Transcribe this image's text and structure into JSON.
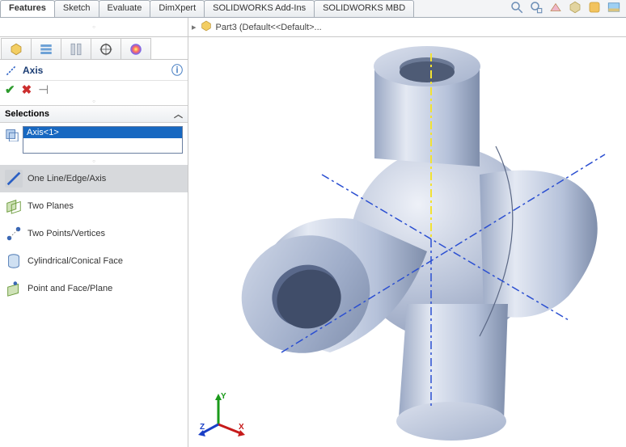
{
  "cmd_tabs": [
    "Features",
    "Sketch",
    "Evaluate",
    "DimXpert",
    "SOLIDWORKS Add-Ins",
    "SOLIDWORKS MBD"
  ],
  "cmd_active_index": 0,
  "breadcrumb": {
    "part_label": "Part3  (Default<<Default>..."
  },
  "pm": {
    "title": "Axis",
    "ok_tip": "OK",
    "cancel_tip": "Cancel",
    "pin_tip": "Keep Visible",
    "help_tip": "Help"
  },
  "selections": {
    "header": "Selections",
    "items": [
      "Axis<1>"
    ]
  },
  "options": [
    {
      "label": "One Line/Edge/Axis",
      "active": true
    },
    {
      "label": "Two Planes",
      "active": false
    },
    {
      "label": "Two Points/Vertices",
      "active": false
    },
    {
      "label": "Cylindrical/Conical Face",
      "active": false
    },
    {
      "label": "Point and Face/Plane",
      "active": false
    }
  ],
  "triad": {
    "x": "X",
    "y": "Y",
    "z": "Z"
  },
  "heads_up_icons": [
    "zoom-to-fit-icon",
    "zoom-to-area-icon",
    "section-view-icon",
    "view-orientation-icon",
    "edit-appearance-icon",
    "apply-scene-icon"
  ]
}
